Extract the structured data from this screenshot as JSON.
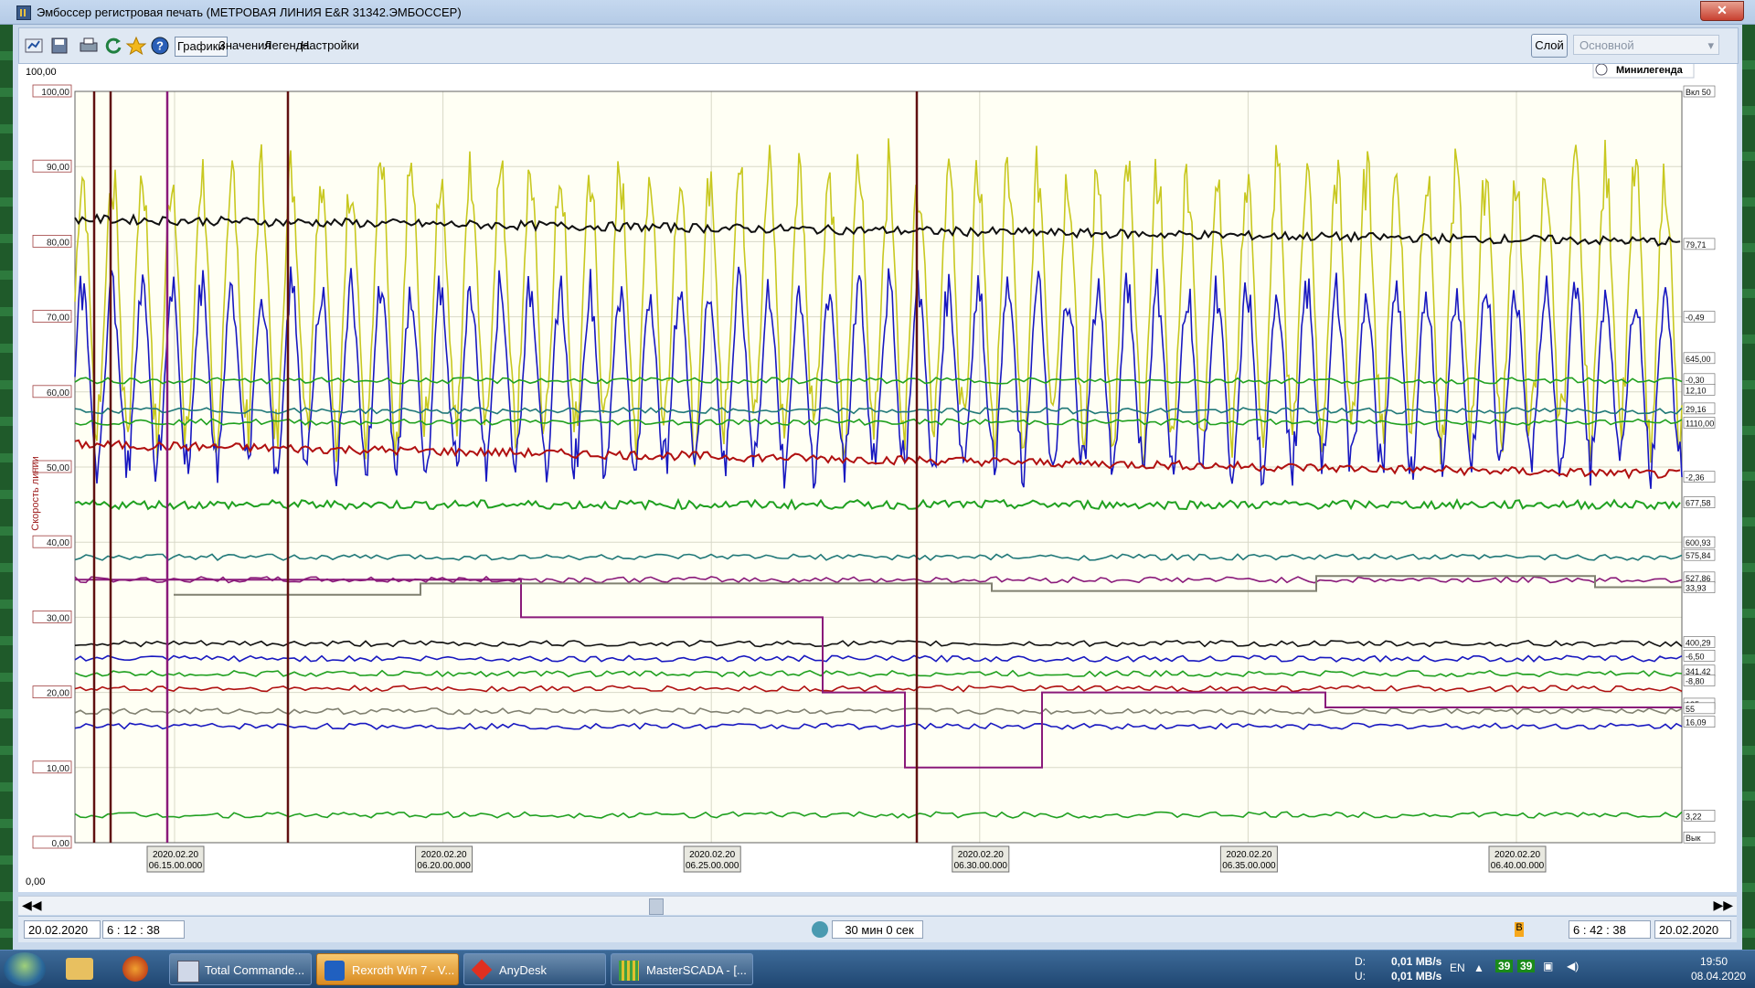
{
  "window": {
    "title": "Эмбоссер регистровая печать (МЕТРОВАЯ ЛИНИЯ E&R 31342.ЭМБОССЕР)",
    "close": "✕"
  },
  "toolbar": {
    "tabs": [
      "Графики",
      "Значения",
      "Легенда",
      "Настройки"
    ],
    "layer_button": "Слой",
    "layer_select": "Основной",
    "icons": [
      "trend-settings-icon",
      "save-icon",
      "print-icon",
      "refresh-icon",
      "favorite-star-icon",
      "help-icon"
    ]
  },
  "chart_header": {
    "top_value": "100,00",
    "minilegend": "Минилегенда",
    "bottom_value": "0,00"
  },
  "axis_title": "Скорость линии",
  "colors": {
    "yellow": "#c8c820",
    "blue": "#1818c0",
    "black": "#101010",
    "red": "#b01010",
    "green": "#20a020",
    "purple": "#8a1a7a",
    "gray": "#808070",
    "teal": "#207878"
  },
  "chart_data": {
    "type": "line",
    "title": "",
    "ylabel": "Скорость линии",
    "ylim": [
      0,
      100
    ],
    "y_ticks": [
      "100,00",
      "90,00",
      "80,00",
      "70,00",
      "60,00",
      "50,00",
      "40,00",
      "30,00",
      "20,00",
      "10,00",
      "0,00"
    ],
    "x_ticks": [
      {
        "date": "2020.02.20",
        "time": "06.15.00.000"
      },
      {
        "date": "2020.02.20",
        "time": "06.20.00.000"
      },
      {
        "date": "2020.02.20",
        "time": "06.25.00.000"
      },
      {
        "date": "2020.02.20",
        "time": "06.30.00.000"
      },
      {
        "date": "2020.02.20",
        "time": "06.35.00.000"
      },
      {
        "date": "2020.02.20",
        "time": "06.40.00.000"
      }
    ],
    "x_range": [
      "06:12:38",
      "06:42:38"
    ],
    "right_labels": [
      "Вкл 50",
      "79,71",
      "-0,49",
      "645,00",
      "-0,30",
      "12,10",
      "29,16",
      "1110,00",
      "-2,36",
      "677,58",
      "600,93",
      "575,84",
      "527,86",
      "33,93",
      "400,29",
      "-6,50",
      "341,42",
      "-8,80",
      "185",
      "55",
      "16,09",
      "3,22",
      "Вык"
    ],
    "series": [
      {
        "color": "yellow",
        "style": "oscillating",
        "center": 72,
        "amplitude": 22
      },
      {
        "color": "blue",
        "style": "oscillating",
        "center": 62,
        "amplitude": 15
      },
      {
        "color": "black",
        "values_start_end": [
          83,
          80
        ]
      },
      {
        "color": "red",
        "values_start_end": [
          53,
          49
        ]
      },
      {
        "color": "green",
        "values_start_end": [
          45,
          45
        ]
      },
      {
        "color": "purple",
        "values": "step"
      },
      {
        "color": "gray",
        "values": "step"
      }
    ]
  },
  "bottom": {
    "start_date": "20.02.2020",
    "start_time": "6 : 12 : 38",
    "period": "30 мин 0 сек",
    "end_time": "6 : 42 : 38",
    "end_date": "20.02.2020",
    "marker": "B"
  },
  "taskbar": {
    "tasks": [
      "Total Commande...",
      "Rexroth Win 7 - V...",
      "AnyDesk",
      "MasterSCADA - [..."
    ],
    "net_labels": [
      "D:",
      "U:"
    ],
    "net_values": [
      "0,01 MB/s",
      "0,01 MB/s"
    ],
    "lang": "EN",
    "badges": [
      "39",
      "39"
    ],
    "time": "19:50",
    "date": "08.04.2020"
  }
}
